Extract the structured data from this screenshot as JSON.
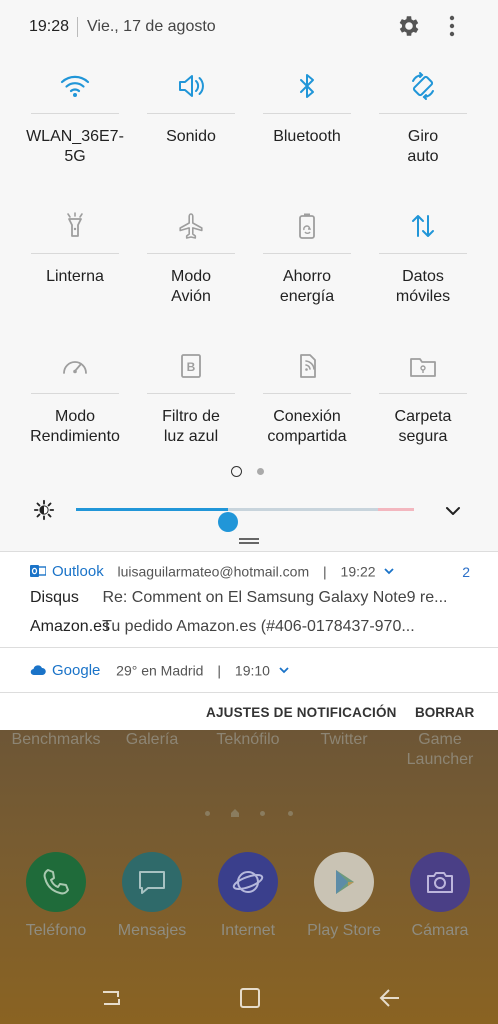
{
  "status": {
    "time": "19:28",
    "date": "Vie., 17 de agosto",
    "icons": [
      "gear-icon",
      "more-vert-icon"
    ]
  },
  "tiles": [
    {
      "label": "WLAN_36E7-\n5G",
      "icon": "wifi-icon",
      "active": true
    },
    {
      "label": "Sonido",
      "icon": "volume-icon",
      "active": true
    },
    {
      "label": "Bluetooth",
      "icon": "bluetooth-icon",
      "active": true
    },
    {
      "label": "Giro\nauto",
      "icon": "auto-rotate-icon",
      "active": true
    },
    {
      "label": "Linterna",
      "icon": "flashlight-icon",
      "active": false
    },
    {
      "label": "Modo\nAvión",
      "icon": "airplane-icon",
      "active": false
    },
    {
      "label": "Ahorro\nenergía",
      "icon": "battery-saver-icon",
      "active": false
    },
    {
      "label": "Datos\nmóviles",
      "icon": "mobile-data-icon",
      "active": true
    },
    {
      "label": "Modo\nRendimiento",
      "icon": "performance-icon",
      "active": false
    },
    {
      "label": "Filtro de\nluz azul",
      "icon": "blue-light-filter-icon",
      "active": false
    },
    {
      "label": "Conexión\ncompartida",
      "icon": "hotspot-icon",
      "active": false
    },
    {
      "label": "Carpeta\nsegura",
      "icon": "secure-folder-icon",
      "active": false
    }
  ],
  "pages": {
    "current": 1,
    "total": 2
  },
  "brightness": {
    "level": 0.45
  },
  "notifications": {
    "outlook": {
      "app": "Outlook",
      "account": "luisaguilarmateo@hotmail.com",
      "time": "19:22",
      "count": "2",
      "rows": [
        {
          "sender": "Disqus",
          "message": "Re: Comment on El Samsung Galaxy Note9 re..."
        },
        {
          "sender": "Amazon.es",
          "message": "Tu pedido Amazon.es (#406-0178437-970..."
        }
      ]
    },
    "google": {
      "app": "Google",
      "text": "29° en Madrid",
      "time": "19:10"
    }
  },
  "actions": {
    "settings": "AJUSTES DE NOTIFICACIÓN",
    "clear": "BORRAR"
  },
  "home": {
    "row_labels": [
      "Benchmarks",
      "Galería",
      "Teknófilo",
      "Twitter",
      "Game\nLauncher"
    ],
    "dock": [
      {
        "label": "Teléfono",
        "icon": "phone-icon",
        "color": "#1f6b3a"
      },
      {
        "label": "Mensajes",
        "icon": "messages-icon",
        "color": "#2f6a6a"
      },
      {
        "label": "Internet",
        "icon": "internet-icon",
        "color": "#3a3f8c"
      },
      {
        "label": "Play Store",
        "icon": "play-store-icon",
        "color": "#c9c3b4"
      },
      {
        "label": "Cámara",
        "icon": "camera-icon",
        "color": "#4a3f86"
      }
    ]
  },
  "colors": {
    "accent": "#2196d8",
    "inactive_icon": "#9e9e9e"
  }
}
